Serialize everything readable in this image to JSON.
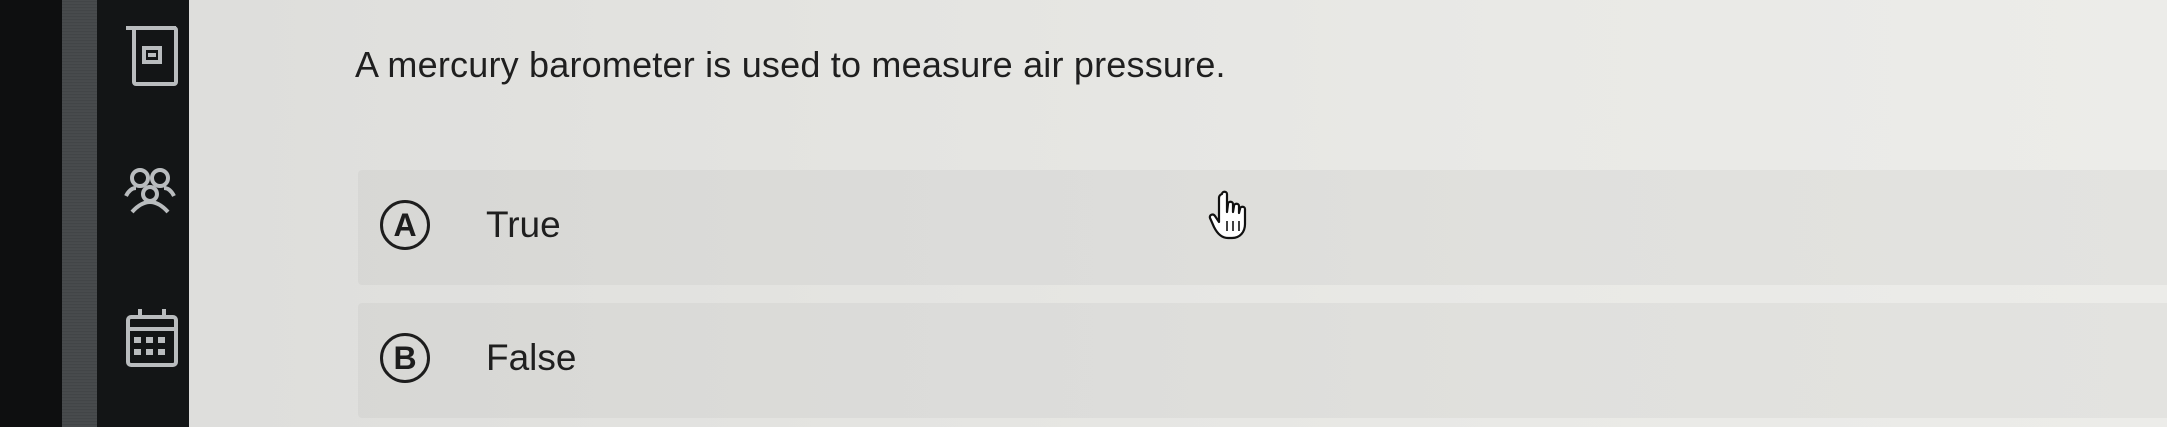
{
  "sidebar": {
    "icons": [
      "notebook-icon",
      "people-icon",
      "calendar-icon"
    ]
  },
  "question": {
    "text": "A mercury barometer is used to measure air pressure."
  },
  "options": [
    {
      "letter": "A",
      "label": "True"
    },
    {
      "letter": "B",
      "label": "False"
    }
  ],
  "colors": {
    "sidebar": "#131516",
    "background": "#e6e6e3",
    "text": "#1f1f1f"
  }
}
